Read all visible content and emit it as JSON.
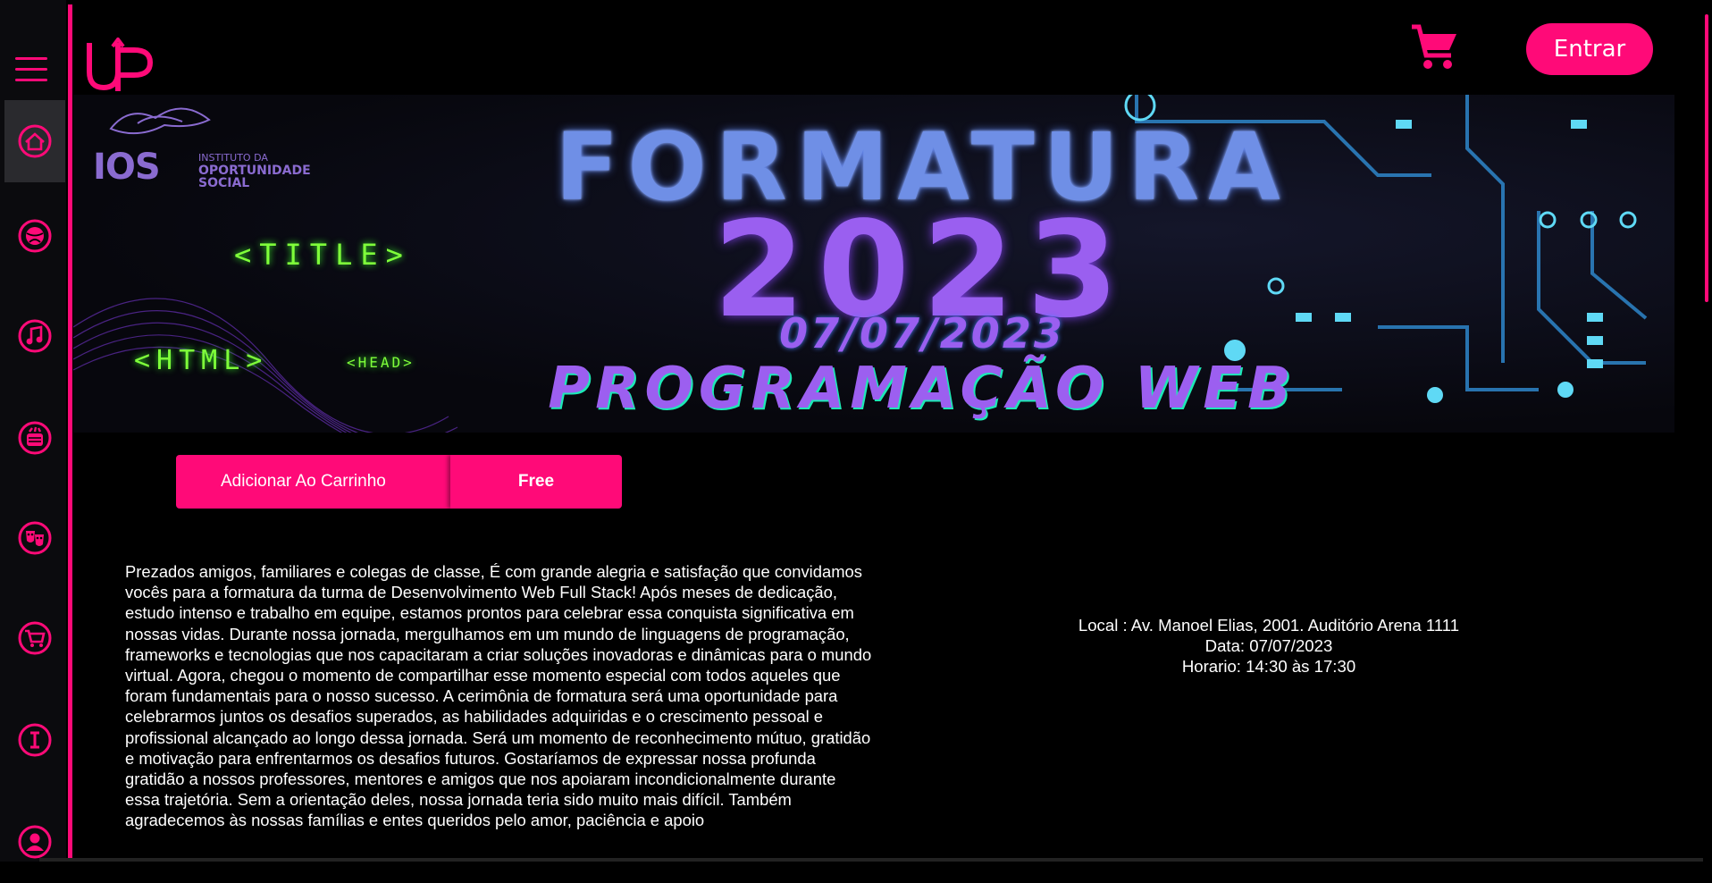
{
  "app": {
    "logo_text": "UP",
    "login_label": "Entrar",
    "accent_color": "#ff0a78"
  },
  "sidebar": {
    "items": [
      {
        "name": "home",
        "icon": "home-icon",
        "active": true
      },
      {
        "name": "sports",
        "icon": "ball-icon",
        "active": false
      },
      {
        "name": "music",
        "icon": "music-note-icon",
        "active": false
      },
      {
        "name": "food",
        "icon": "food-icon",
        "active": false
      },
      {
        "name": "theater",
        "icon": "theater-masks-icon",
        "active": false
      },
      {
        "name": "shop",
        "icon": "cart-icon",
        "active": false
      },
      {
        "name": "info",
        "icon": "info-icon",
        "active": false
      },
      {
        "name": "profile",
        "icon": "user-icon",
        "active": false
      }
    ]
  },
  "banner": {
    "org_short": "IOS",
    "org_line1": "INSTITUTO DA",
    "org_line2": "OPORTUNIDADE",
    "org_line3": "SOCIAL",
    "title": "FORMATURA",
    "year": "2023",
    "date": "07/07/2023",
    "subtitle": "PROGRAMAÇÃO WEB",
    "tag_title": "<TITLE>",
    "tag_html": "<HTML>",
    "tag_head": "<HEAD>"
  },
  "actions": {
    "add_to_cart_label": "Adicionar Ao Carrinho",
    "price_label": "Free"
  },
  "event": {
    "description": "Prezados amigos, familiares e colegas de classe, É com grande alegria e satisfação que convidamos vocês para a formatura da turma de Desenvolvimento Web Full Stack! Após meses de dedicação, estudo intenso e trabalho em equipe, estamos prontos para celebrar essa conquista significativa em nossas vidas. Durante nossa jornada, mergulhamos em um mundo de linguagens de programação, frameworks e tecnologias que nos capacitaram a criar soluções inovadoras e dinâmicas para o mundo virtual. Agora, chegou o momento de compartilhar esse momento especial com todos aqueles que foram fundamentais para o nosso sucesso. A cerimônia de formatura será uma oportunidade para celebrarmos juntos os desafios superados, as habilidades adquiridas e o crescimento pessoal e profissional alcançado ao longo dessa jornada. Será um momento de reconhecimento mútuo, gratidão e motivação para enfrentarmos os desafios futuros. Gostaríamos de expressar nossa profunda gratidão a nossos professores, mentores e amigos que nos apoiaram incondicionalmente durante essa trajetória. Sem a orientação deles, nossa jornada teria sido muito mais difícil. Também agradecemos às nossas famílias e entes queridos pelo amor, paciência e apoio",
    "location": "Local : Av. Manoel Elias, 2001. Auditório Arena 1111",
    "date": "Data: 07/07/2023",
    "time": "Horario: 14:30 às 17:30"
  }
}
